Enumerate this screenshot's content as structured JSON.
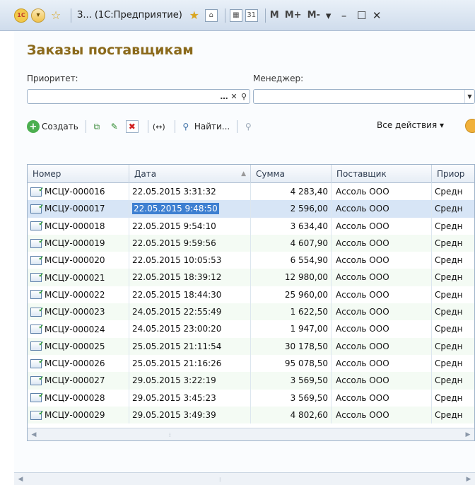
{
  "window": {
    "title": "З... (1С:Предприятие)",
    "m_label": "M",
    "mplus_label": "M+",
    "mminus_label": "M-",
    "dropdown_label": "▾",
    "minimize": "–",
    "maximize": "☐",
    "close": "✕"
  },
  "page": {
    "title": "Заказы поставщикам"
  },
  "filters": {
    "priority_label": "Приоритет:",
    "priority_value": "",
    "manager_label": "Менеджер:",
    "manager_value": ""
  },
  "toolbar": {
    "create_label": "Создать",
    "find_label": "Найти...",
    "all_actions_label": "Все действия ▾"
  },
  "table": {
    "columns": [
      "Номер",
      "Дата",
      "Сумма",
      "Поставщик",
      "Приор"
    ],
    "rows": [
      {
        "num": "МСЦУ-000016",
        "date": "22.05.2015 3:31:32",
        "sum": "4 283,40",
        "supplier": "Ассоль ООО",
        "priority": "Средн"
      },
      {
        "num": "МСЦУ-000017",
        "date": "22.05.2015 9:48:50",
        "sum": "2 596,00",
        "supplier": "Ассоль ООО",
        "priority": "Средн"
      },
      {
        "num": "МСЦУ-000018",
        "date": "22.05.2015 9:54:10",
        "sum": "3 634,40",
        "supplier": "Ассоль ООО",
        "priority": "Средн"
      },
      {
        "num": "МСЦУ-000019",
        "date": "22.05.2015 9:59:56",
        "sum": "4 607,90",
        "supplier": "Ассоль ООО",
        "priority": "Средн"
      },
      {
        "num": "МСЦУ-000020",
        "date": "22.05.2015 10:05:53",
        "sum": "6 554,90",
        "supplier": "Ассоль ООО",
        "priority": "Средн"
      },
      {
        "num": "МСЦУ-000021",
        "date": "22.05.2015 18:39:12",
        "sum": "12 980,00",
        "supplier": "Ассоль ООО",
        "priority": "Средн"
      },
      {
        "num": "МСЦУ-000022",
        "date": "22.05.2015 18:44:30",
        "sum": "25 960,00",
        "supplier": "Ассоль ООО",
        "priority": "Средн"
      },
      {
        "num": "МСЦУ-000023",
        "date": "24.05.2015 22:55:49",
        "sum": "1 622,50",
        "supplier": "Ассоль ООО",
        "priority": "Средн"
      },
      {
        "num": "МСЦУ-000024",
        "date": "24.05.2015 23:00:20",
        "sum": "1 947,00",
        "supplier": "Ассоль ООО",
        "priority": "Средн"
      },
      {
        "num": "МСЦУ-000025",
        "date": "25.05.2015 21:11:54",
        "sum": "30 178,50",
        "supplier": "Ассоль ООО",
        "priority": "Средн"
      },
      {
        "num": "МСЦУ-000026",
        "date": "25.05.2015 21:16:26",
        "sum": "95 078,50",
        "supplier": "Ассоль ООО",
        "priority": "Средн"
      },
      {
        "num": "МСЦУ-000027",
        "date": "29.05.2015 3:22:19",
        "sum": "3 569,50",
        "supplier": "Ассоль ООО",
        "priority": "Средн"
      },
      {
        "num": "МСЦУ-000028",
        "date": "29.05.2015 3:45:23",
        "sum": "3 569,50",
        "supplier": "Ассоль ООО",
        "priority": "Средн"
      },
      {
        "num": "МСЦУ-000029",
        "date": "29.05.2015 3:49:39",
        "sum": "4 802,60",
        "supplier": "Ассоль ООО",
        "priority": "Средн"
      }
    ],
    "selected_row": 1
  },
  "colors": {
    "title": "#8b6a1c",
    "selection": "#3d7fd1",
    "border": "#9db2c9"
  }
}
